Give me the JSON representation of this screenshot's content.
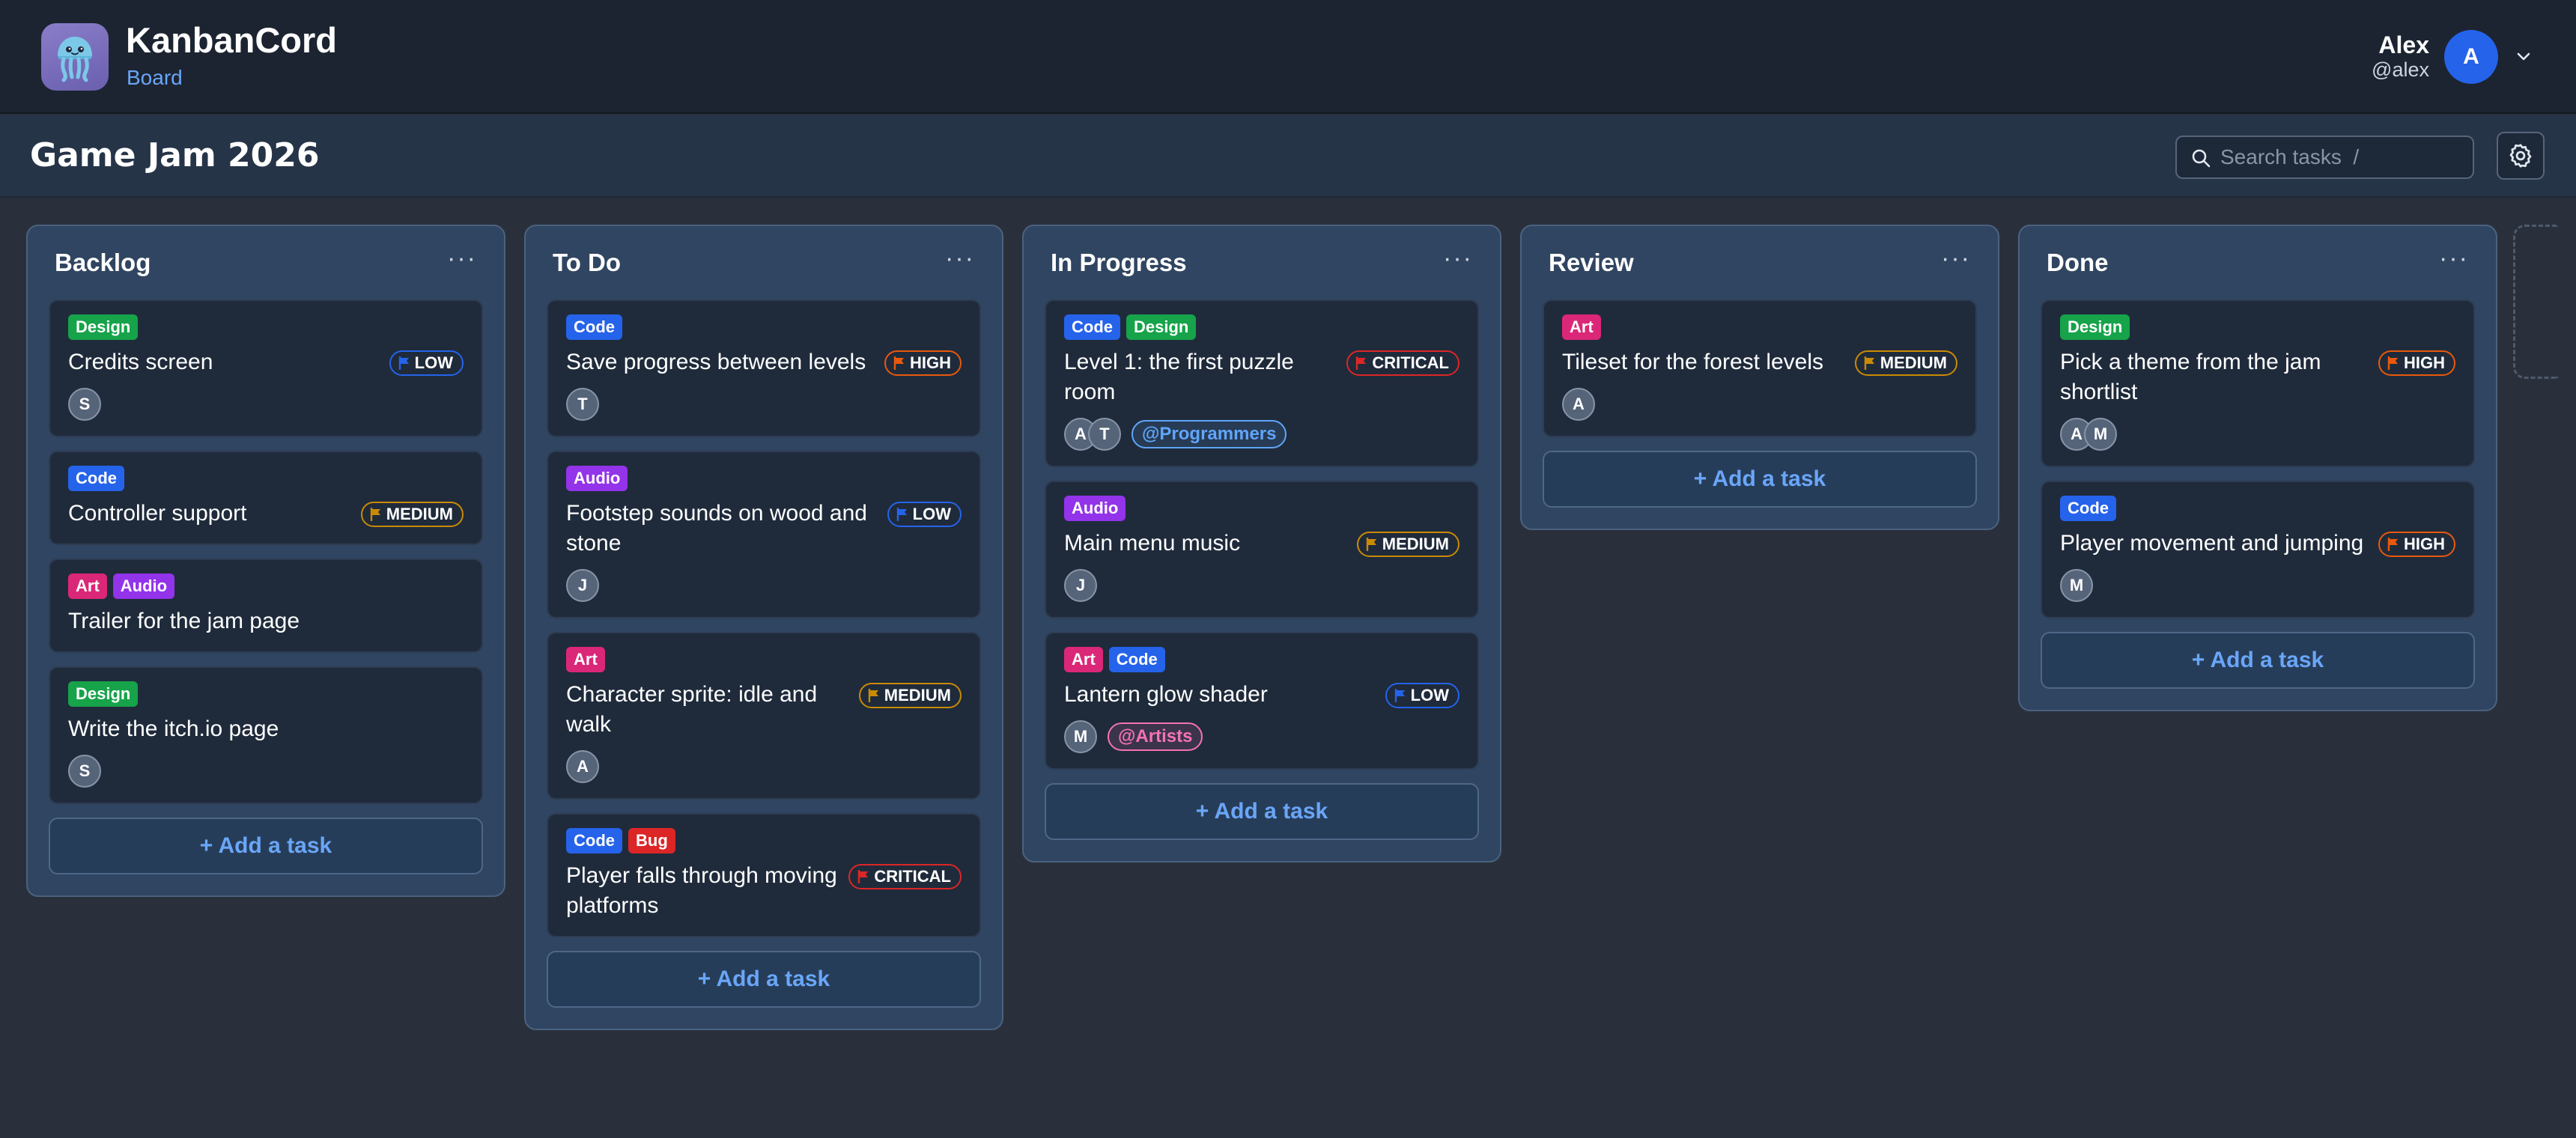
{
  "app": {
    "title": "KanbanCord",
    "subtitle": "Board"
  },
  "user": {
    "name": "Alex",
    "handle": "@alex",
    "initial": "A"
  },
  "board": {
    "title": "Game Jam 2026"
  },
  "search": {
    "placeholder": "Search tasks  /"
  },
  "colors": {
    "Design": "#16a34a",
    "Code": "#2563eb",
    "Art": "#db2777",
    "Audio": "#9333ea",
    "Bug": "#dc2626",
    "LOW": "#2563eb",
    "MEDIUM": "#ca8a04",
    "HIGH": "#ea580c",
    "CRITICAL": "#dc2626",
    "@Programmers": "#60a5fa",
    "@Artists": "#f472b6"
  },
  "add_task_label": "+ Add a task",
  "column_menu_label": "···",
  "columns": [
    {
      "title": "Backlog",
      "cards": [
        {
          "tags": [
            "Design"
          ],
          "title": "Credits screen",
          "priority": "LOW",
          "assignees": [
            "S"
          ],
          "mention": ""
        },
        {
          "tags": [
            "Code"
          ],
          "title": "Controller support",
          "priority": "MEDIUM",
          "assignees": [],
          "mention": ""
        },
        {
          "tags": [
            "Art",
            "Audio"
          ],
          "title": "Trailer for the jam page",
          "priority": "",
          "assignees": [],
          "mention": ""
        },
        {
          "tags": [
            "Design"
          ],
          "title": "Write the itch.io page",
          "priority": "",
          "assignees": [
            "S"
          ],
          "mention": ""
        }
      ]
    },
    {
      "title": "To Do",
      "cards": [
        {
          "tags": [
            "Code"
          ],
          "title": "Save progress between levels",
          "priority": "HIGH",
          "assignees": [
            "T"
          ],
          "mention": ""
        },
        {
          "tags": [
            "Audio"
          ],
          "title": "Footstep sounds on wood and stone",
          "priority": "LOW",
          "assignees": [
            "J"
          ],
          "mention": ""
        },
        {
          "tags": [
            "Art"
          ],
          "title": "Character sprite: idle and walk",
          "priority": "MEDIUM",
          "assignees": [
            "A"
          ],
          "mention": ""
        },
        {
          "tags": [
            "Code",
            "Bug"
          ],
          "title": "Player falls through moving platforms",
          "priority": "CRITICAL",
          "assignees": [],
          "mention": ""
        }
      ]
    },
    {
      "title": "In Progress",
      "cards": [
        {
          "tags": [
            "Code",
            "Design"
          ],
          "title": "Level 1: the first puzzle room",
          "priority": "CRITICAL",
          "assignees": [
            "A",
            "T"
          ],
          "mention": "@Programmers"
        },
        {
          "tags": [
            "Audio"
          ],
          "title": "Main menu music",
          "priority": "MEDIUM",
          "assignees": [
            "J"
          ],
          "mention": ""
        },
        {
          "tags": [
            "Art",
            "Code"
          ],
          "title": "Lantern glow shader",
          "priority": "LOW",
          "assignees": [
            "M"
          ],
          "mention": "@Artists"
        }
      ]
    },
    {
      "title": "Review",
      "cards": [
        {
          "tags": [
            "Art"
          ],
          "title": "Tileset for the forest levels",
          "priority": "MEDIUM",
          "assignees": [
            "A"
          ],
          "mention": ""
        }
      ]
    },
    {
      "title": "Done",
      "cards": [
        {
          "tags": [
            "Design"
          ],
          "title": "Pick a theme from the jam shortlist",
          "priority": "HIGH",
          "assignees": [
            "A",
            "M"
          ],
          "mention": ""
        },
        {
          "tags": [
            "Code"
          ],
          "title": "Player movement and jumping",
          "priority": "HIGH",
          "assignees": [
            "M"
          ],
          "mention": ""
        }
      ]
    }
  ]
}
